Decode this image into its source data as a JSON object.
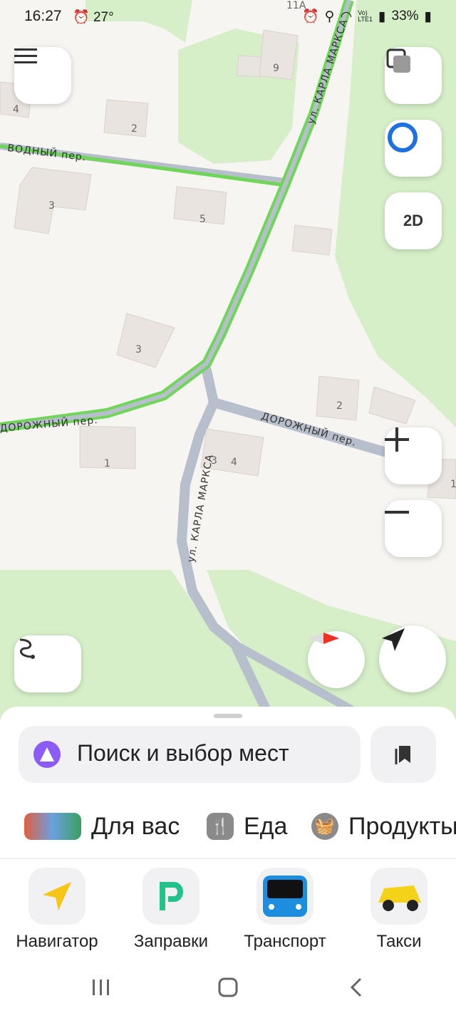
{
  "status": {
    "time": "16:27",
    "temp": "27°",
    "network": "Vo)\nLTE1",
    "battery": "33%"
  },
  "map": {
    "streets": {
      "karla_marksa_top": "ул. КАРЛА МАРКСА",
      "karla_marksa_bottom": "ул. КАРЛА МАРКСА",
      "vodny": "ВОДНЫЙ пер.",
      "dorozhny_left": "ДОРОЖНЫЙ пер.",
      "dorozhny_right": "ДОРОЖНЫЙ пер."
    },
    "house_numbers": [
      "11А",
      "9",
      "4",
      "2",
      "3",
      "5",
      "3",
      "2",
      "3",
      "4",
      "1",
      "1"
    ],
    "mode_label": "2D"
  },
  "sheet": {
    "search_placeholder": "Поиск и выбор мест",
    "chips": [
      "Для вас",
      "Еда",
      "Продукты"
    ],
    "apps": [
      "Навигатор",
      "Заправки",
      "Транспорт",
      "Такси"
    ]
  },
  "colors": {
    "accent": "#8b5cf6",
    "traffic_green": "#6fd65a",
    "road": "#b8bfcc",
    "park": "#d6efc9"
  }
}
